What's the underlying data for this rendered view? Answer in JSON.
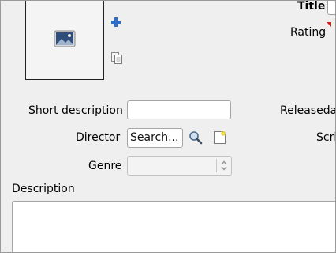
{
  "cover": {
    "image_icon": "picture-icon",
    "add_icon": "plus-icon",
    "copy_icon": "copy-icon"
  },
  "fields": {
    "title_label": "Title",
    "rating_label": "Rating",
    "short_description_label": "Short description",
    "short_description_value": "",
    "releasedate_label": "Releaseda",
    "director_label": "Director",
    "director_placeholder": "Search...",
    "script_label": "Scri",
    "genre_label": "Genre",
    "genre_value": "",
    "description_label": "Description",
    "description_value": ""
  },
  "icons": {
    "search": "magnifier-icon",
    "new_note": "note-icon"
  },
  "colors": {
    "rating_marker": "#d01c1c",
    "add_icon": "#2a6fcf"
  }
}
